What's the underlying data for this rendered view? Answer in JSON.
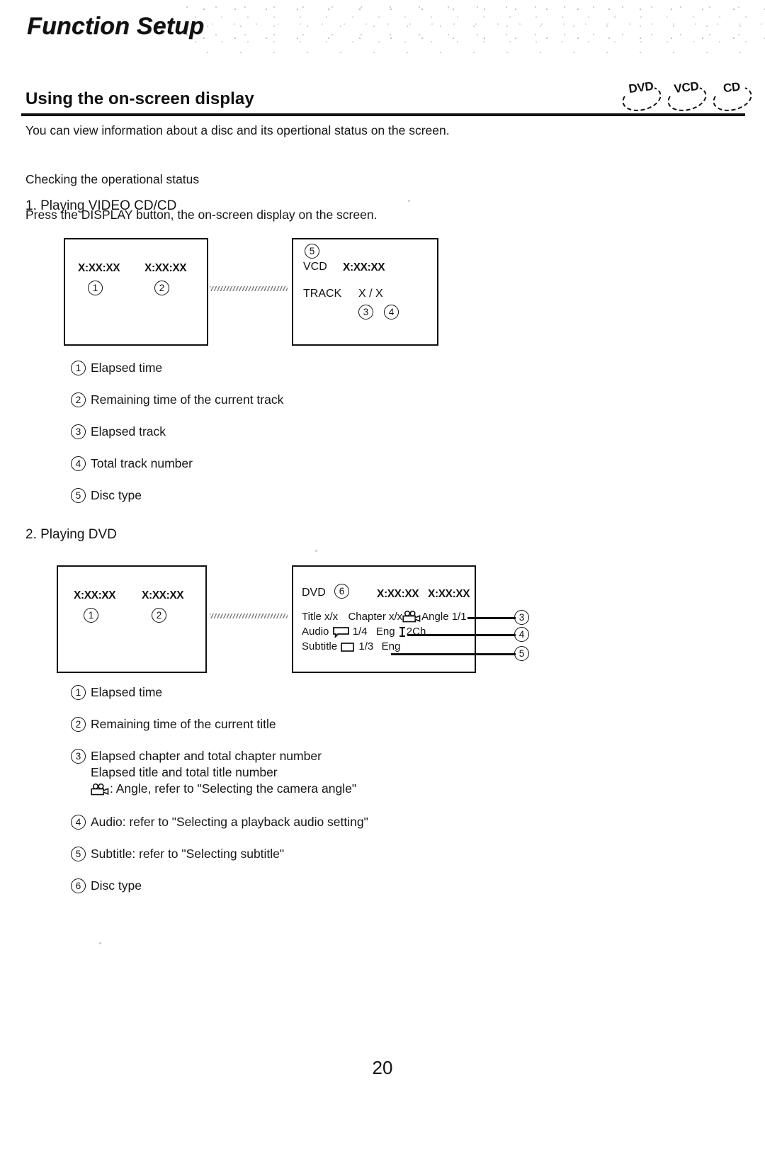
{
  "header": {
    "running_title": "Function Setup"
  },
  "section": {
    "title": "Using the on-screen display",
    "disc_badges": [
      {
        "label": "DVD",
        "icon": "disc-badge-icon"
      },
      {
        "label": "VCD",
        "icon": "disc-badge-icon"
      },
      {
        "label": "CD",
        "icon": "disc-badge-icon"
      }
    ]
  },
  "body": {
    "intro": "You can view information about a disc and its opertional status on the screen.",
    "checking_line1": "Checking the operational status",
    "checking_line2": "Press the DISPLAY button, the on-screen display on the screen."
  },
  "step1": {
    "heading": "1. Playing VIDEO CD/CD",
    "panel_left": {
      "time_elapsed": "X:XX:XX",
      "time_remaining": "X:XX:XX",
      "marker_1": "1",
      "marker_2": "2"
    },
    "panel_right": {
      "marker_5": "5",
      "disc_type": "VCD",
      "time": "X:XX:XX",
      "track_label": "TRACK",
      "track_value": "X / X",
      "marker_3": "3",
      "marker_4": "4"
    },
    "legend": [
      {
        "num": "1",
        "text": "Elapsed time"
      },
      {
        "num": "2",
        "text": "Remaining time of the current track"
      },
      {
        "num": "3",
        "text": "Elapsed track"
      },
      {
        "num": "4",
        "text": "Total track number"
      },
      {
        "num": "5",
        "text": "Disc type"
      }
    ]
  },
  "step2": {
    "heading": "2. Playing DVD",
    "panel_left": {
      "time_elapsed": "X:XX:XX",
      "time_remaining": "X:XX:XX",
      "marker_1": "1",
      "marker_2": "2"
    },
    "panel_right": {
      "disc_type": "DVD",
      "marker_6": "6",
      "time_elapsed": "X:XX:XX",
      "time_remaining": "X:XX:XX",
      "row_title": "Title x/x",
      "row_chapter": "Chapter x/x",
      "row_angle": "Angle 1/1",
      "row_audio_label": "Audio",
      "row_audio_value": "1/4",
      "row_audio_lang": "Eng",
      "row_audio_channel": "2Ch",
      "row_subtitle_label": "Subtitle",
      "row_subtitle_value": "1/3",
      "row_subtitle_lang": "Eng",
      "callout_3": "3",
      "callout_4": "4",
      "callout_5": "5"
    },
    "legend": [
      {
        "num": "1",
        "text": "Elapsed time"
      },
      {
        "num": "2",
        "text": "Remaining time of the current title"
      },
      {
        "num": "3",
        "text": "Elapsed chapter and total chapter number"
      },
      {
        "num": "4",
        "text": "Audio: refer to \"Selecting a playback audio setting\""
      },
      {
        "num": "5",
        "text": "Subtitle: refer to \"Selecting subtitle\""
      },
      {
        "num": "6",
        "text": "Disc type"
      }
    ],
    "legend3_line2": "Elapsed title and total title number",
    "legend3_line3": ": Angle, refer to \"Selecting the camera angle\""
  },
  "footer": {
    "page_number": "20"
  }
}
